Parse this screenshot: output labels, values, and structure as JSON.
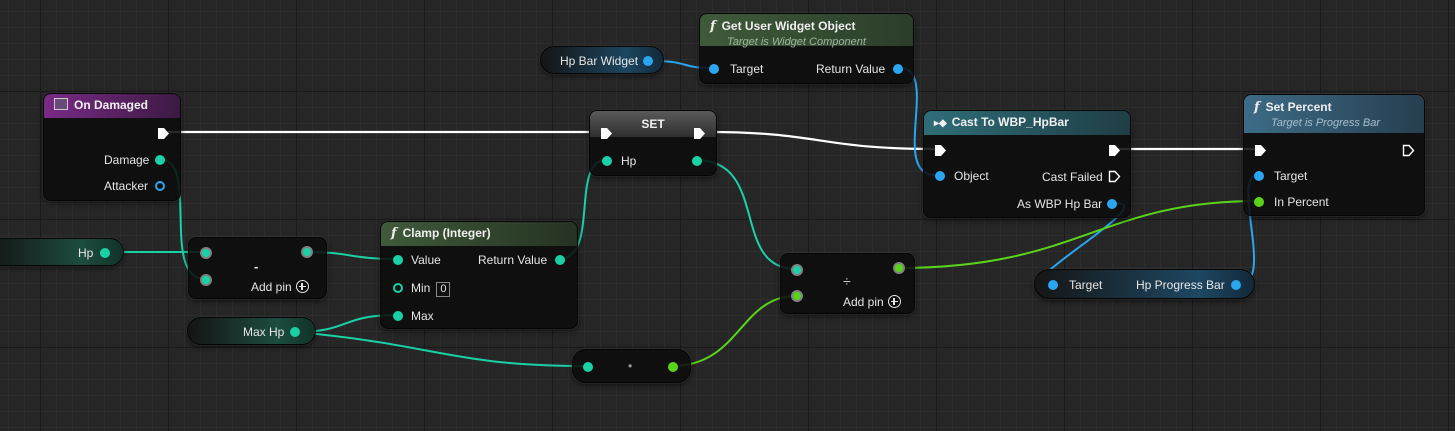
{
  "colors": {
    "event_header": "#7a2a86",
    "function_header": "#3f5a3a",
    "cast_header": "#2f6d78",
    "target_header": "#3d6b86",
    "integer_pin": "#1ad1a5",
    "object_pin": "#2aa6f0",
    "float_pin": "#5ad41a",
    "exec_pin": "#ffffff"
  },
  "on_damaged": {
    "title": "On Damaged",
    "icon": "event-icon",
    "pins": {
      "damage": "Damage",
      "attacker": "Attacker"
    }
  },
  "get_widget": {
    "title": "Get User Widget Object",
    "subtitle": "Target is Widget Component",
    "pins": {
      "target": "Target",
      "return_value": "Return Value"
    }
  },
  "set_node": {
    "title": "SET",
    "pins": {
      "hp": "Hp"
    }
  },
  "cast_node": {
    "title": "Cast To WBP_HpBar",
    "pins": {
      "object": "Object",
      "cast_failed": "Cast Failed",
      "as_wbp": "As WBP Hp Bar"
    }
  },
  "set_percent": {
    "title": "Set Percent",
    "subtitle": "Target is Progress Bar",
    "pins": {
      "target": "Target",
      "in_percent": "In Percent"
    }
  },
  "clamp_node": {
    "title": "Clamp (Integer)",
    "pins": {
      "value": "Value",
      "return_value": "Return Value",
      "min": "Min",
      "min_value": "0",
      "max": "Max"
    }
  },
  "subtract_node": {
    "symbol": "-",
    "add_pin": "Add pin"
  },
  "divide_node": {
    "symbol": "÷",
    "add_pin": "Add pin"
  },
  "convert_node": {
    "symbol": "•"
  },
  "variables": {
    "hp_bar_widget": "Hp Bar Widget",
    "hp_getter": "Hp",
    "max_hp": "Max Hp",
    "progress_bar_get": {
      "target": "Target",
      "value": "Hp Progress Bar"
    }
  }
}
